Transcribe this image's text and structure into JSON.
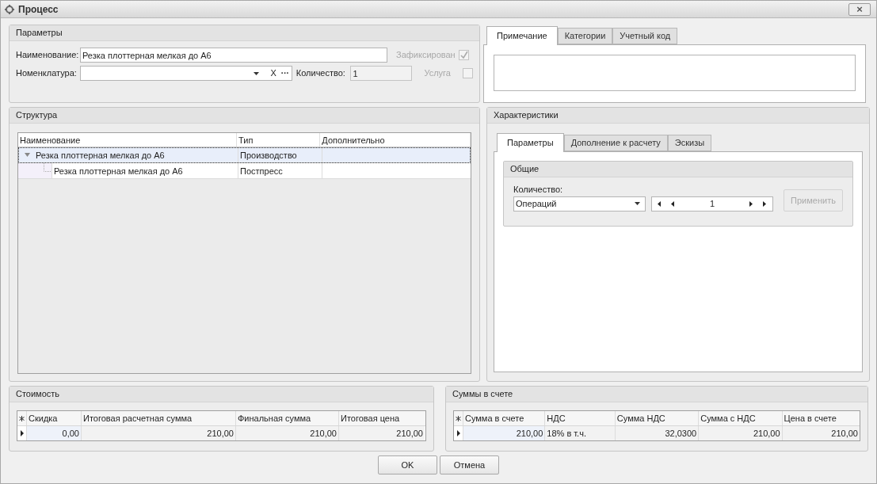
{
  "window": {
    "title": "Процесс",
    "close": "×"
  },
  "parameters": {
    "title": "Параметры",
    "name_label": "Наименование:",
    "name_value": "Резка плоттерная мелкая до А6",
    "fixed_label": "Зафиксирован",
    "fixed_checked": true,
    "fixed_disabled": true,
    "nomenclature_label": "Номенклатура:",
    "clear": "X",
    "more": "···",
    "quantity_label": "Количество:",
    "quantity_value": "1",
    "service_label": "Услуга",
    "service_checked": false,
    "service_disabled": true
  },
  "note_tabs": [
    {
      "label": "Примечание",
      "selected": true
    },
    {
      "label": "Категории",
      "selected": false
    },
    {
      "label": "Учетный код",
      "selected": false
    }
  ],
  "structure": {
    "title": "Структура",
    "columns": [
      "Наименование",
      "Тип",
      "Дополнительно"
    ],
    "rows": [
      {
        "name": "Резка плоттерная мелкая до А6",
        "type": "Производство",
        "selected": true,
        "expanded": true,
        "children": [
          {
            "name": "Резка плоттерная мелкая до А6",
            "type": "Постпресс",
            "selected": false
          }
        ]
      }
    ]
  },
  "characteristics": {
    "title": "Характеристики",
    "tabs": [
      {
        "label": "Параметры",
        "selected": true
      },
      {
        "label": "Дополнение к расчету",
        "selected": false
      },
      {
        "label": "Эскизы",
        "selected": false
      }
    ],
    "group": {
      "title": "Общие",
      "quantity_label": "Количество:",
      "unit": "Операций",
      "spinner_value": "1",
      "apply": "Применить",
      "apply_disabled": true
    }
  },
  "cost": {
    "title": "Стоимость",
    "columns": [
      "Скидка",
      "Итоговая расчетная сумма",
      "Финальная сумма",
      "Итоговая цена"
    ],
    "rows": [
      [
        "0,00",
        "210,00",
        "210,00",
        "210,00"
      ]
    ]
  },
  "invoice": {
    "title": "Суммы в счете",
    "columns": [
      "Сумма в счете",
      "НДС",
      "Сумма НДС",
      "Сумма с НДС",
      "Цена в счете"
    ],
    "rows": [
      [
        "210,00",
        "18% в т.ч.",
        "32,0300",
        "210,00",
        "210,00"
      ]
    ]
  },
  "buttons": [
    "OK",
    "Отмена"
  ]
}
